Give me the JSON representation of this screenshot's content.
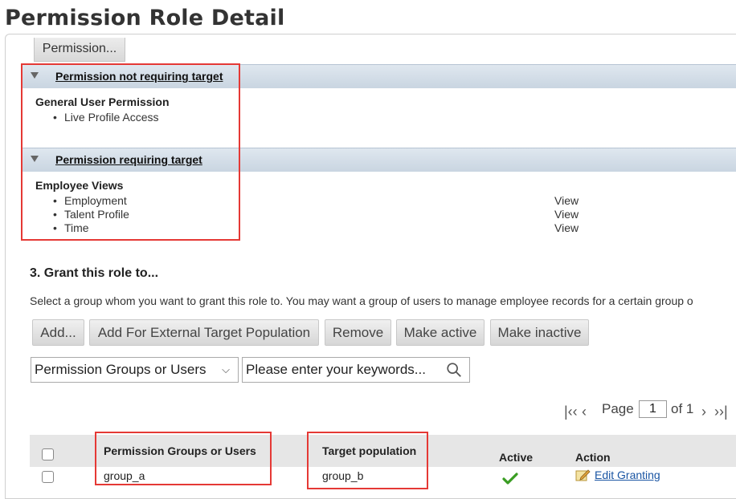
{
  "page": {
    "title": "Permission Role Detail"
  },
  "permission_button": "Permission...",
  "sections": [
    {
      "title": "Permission not requiring target",
      "groups": [
        {
          "name": "General User Permission",
          "items": [
            {
              "label": "Live Profile Access",
              "access": ""
            }
          ]
        }
      ]
    },
    {
      "title": "Permission requiring target",
      "groups": [
        {
          "name": "Employee Views",
          "items": [
            {
              "label": "Employment",
              "access": "View"
            },
            {
              "label": "Talent Profile",
              "access": "View"
            },
            {
              "label": "Time",
              "access": "View"
            }
          ]
        }
      ]
    }
  ],
  "grant": {
    "title": "3. Grant this role to...",
    "description": "Select a group whom you want to grant this role to. You may want a group of users to manage employee records for a certain group o",
    "buttons": {
      "add": "Add...",
      "add_external": "Add For External Target Population",
      "remove": "Remove",
      "make_active": "Make active",
      "make_inactive": "Make inactive"
    },
    "filter_select": "Permission Groups or Users",
    "search_placeholder": "Please enter your keywords...",
    "pager": {
      "page_label": "Page",
      "page_value": "1",
      "of_label": "of 1"
    },
    "columns": {
      "groups": "Permission Groups or Users",
      "target": "Target population",
      "active": "Active",
      "action": "Action"
    },
    "rows": [
      {
        "group": "group_a",
        "target": "group_b",
        "active": true,
        "action": "Edit Granting"
      }
    ]
  },
  "colors": {
    "highlight_box": "#e53935",
    "section_bar": "#d3dde8",
    "link": "#1a55a3",
    "active_check": "#3a9d23"
  }
}
